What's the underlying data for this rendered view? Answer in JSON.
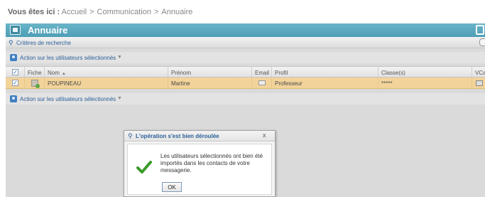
{
  "breadcrumb": {
    "label": "Vous êtes ici :",
    "items": [
      "Accueil",
      "Communication",
      "Annuaire"
    ],
    "separator": ">"
  },
  "header": {
    "title": "Annuaire"
  },
  "criteria": {
    "label": "Critères de recherche"
  },
  "actions": {
    "top_label": "Action sur les utilisateurs sélectionnés",
    "bottom_label": "Action sur les utilisateurs sélectionnés"
  },
  "table": {
    "columns": [
      "Fiche",
      "Nom",
      "Prénom",
      "Email",
      "Profil",
      "Classe(s)",
      "VCar"
    ],
    "sort_indicator": "▲",
    "rows": [
      {
        "nom": "POUPINEAU",
        "prenom": "Martine",
        "profil": "Professeur",
        "classes": "*****",
        "selected": true
      }
    ]
  },
  "dialog": {
    "title": "L'opération s'est bien déroulée",
    "close": "x",
    "message": "Les utilisateurs sélectionnés ont bien été importés dans les contacts de votre messagerie.",
    "ok_label": "OK"
  },
  "colors": {
    "header_bg": "#5aa9bf",
    "row_selected": "#f2d39a",
    "link_blue": "#2b5f99",
    "success_green": "#3a9a2a"
  }
}
